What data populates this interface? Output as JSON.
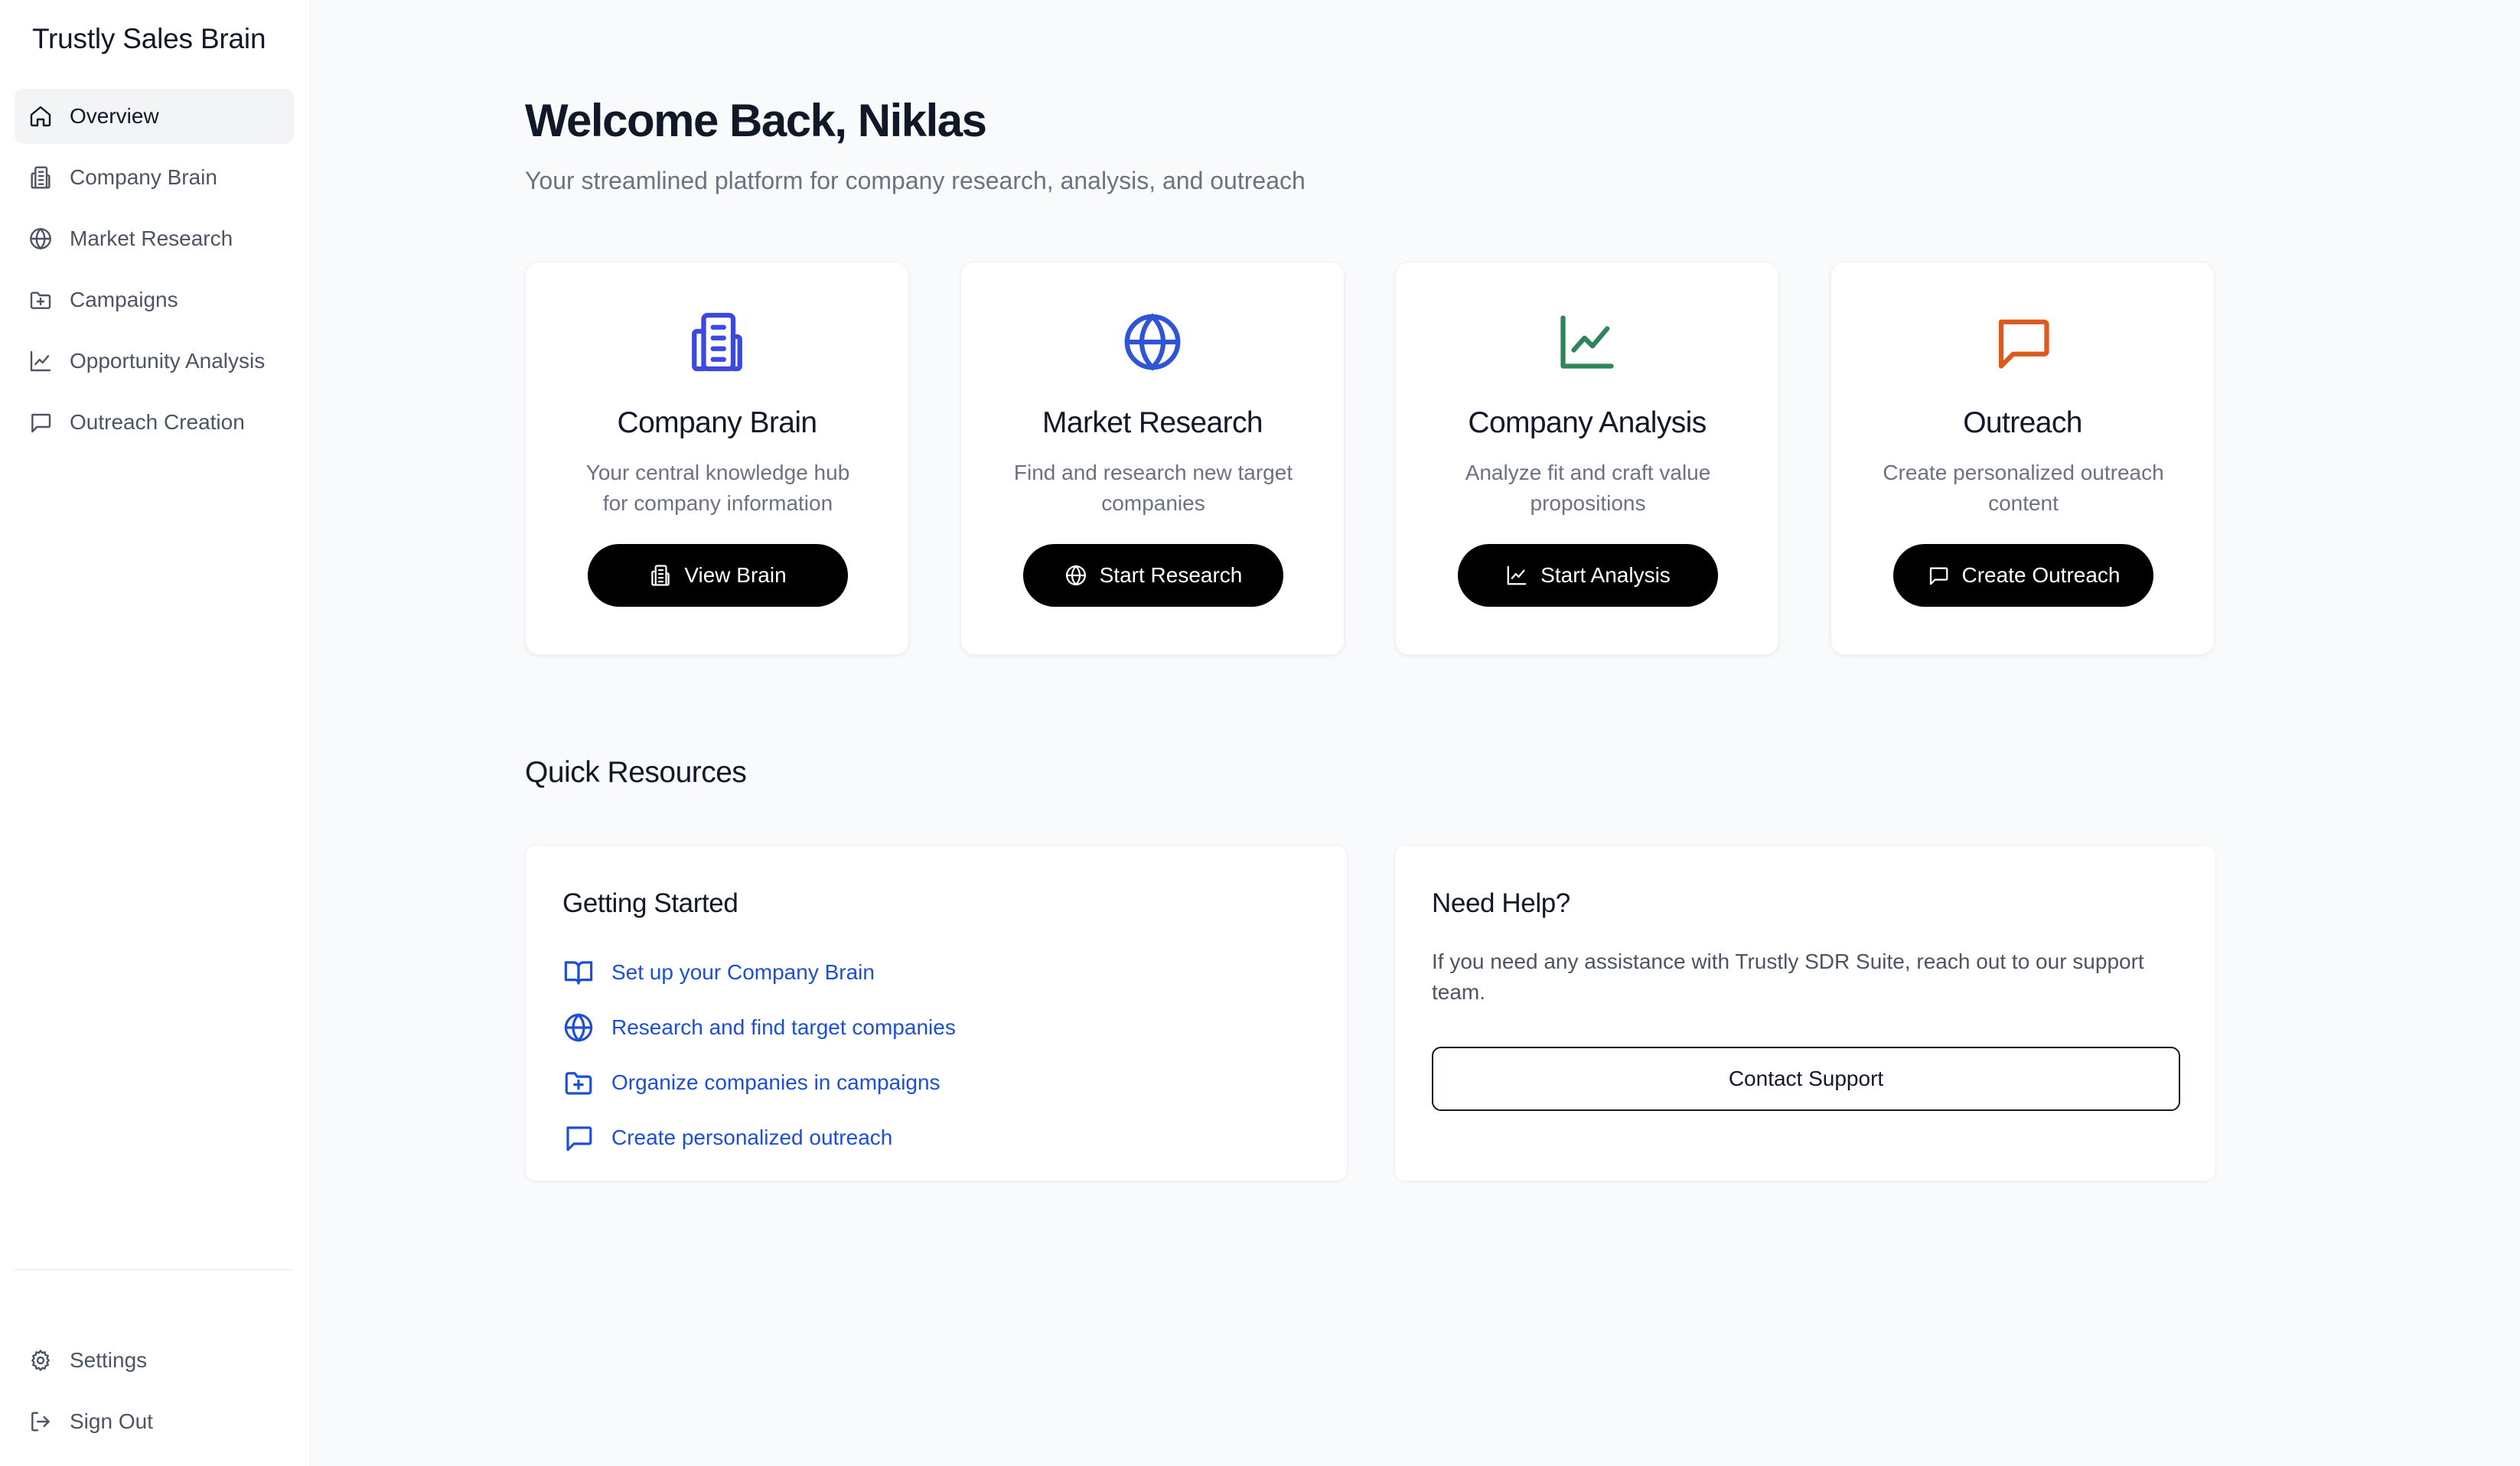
{
  "app": {
    "title": "Trustly Sales Brain"
  },
  "sidebar": {
    "items": [
      {
        "label": "Overview",
        "icon": "home-icon",
        "active": true
      },
      {
        "label": "Company Brain",
        "icon": "building-icon"
      },
      {
        "label": "Market Research",
        "icon": "globe-icon"
      },
      {
        "label": "Campaigns",
        "icon": "folder-plus-icon"
      },
      {
        "label": "Opportunity Analysis",
        "icon": "line-chart-icon"
      },
      {
        "label": "Outreach Creation",
        "icon": "message-square-icon"
      }
    ],
    "bottom_items": [
      {
        "label": "Settings",
        "icon": "gear-icon"
      },
      {
        "label": "Sign Out",
        "icon": "log-out-icon"
      }
    ]
  },
  "header": {
    "title": "Welcome Back, Niklas",
    "subtitle": "Your streamlined platform for company research, analysis, and outreach"
  },
  "cards": [
    {
      "title": "Company Brain",
      "description": "Your central knowledge hub for company information",
      "button": "View Brain",
      "icon": "building-icon",
      "color": "#3b49df"
    },
    {
      "title": "Market Research",
      "description": "Find and research new target companies",
      "button": "Start Research",
      "icon": "globe-icon",
      "color": "#2f55d4"
    },
    {
      "title": "Company Analysis",
      "description": "Analyze fit and craft value propositions",
      "button": "Start Analysis",
      "icon": "line-chart-icon",
      "color": "#2f855a"
    },
    {
      "title": "Outreach",
      "description": "Create personalized outreach content",
      "button": "Create Outreach",
      "icon": "message-square-icon",
      "color": "#dd5a1f"
    }
  ],
  "quick_resources": {
    "title": "Quick Resources",
    "getting_started": {
      "title": "Getting Started",
      "items": [
        {
          "label": "Set up your Company Brain",
          "icon": "book-open-icon"
        },
        {
          "label": "Research and find target companies",
          "icon": "globe-icon"
        },
        {
          "label": "Organize companies in campaigns",
          "icon": "folder-plus-icon"
        },
        {
          "label": "Create personalized outreach",
          "icon": "message-square-icon"
        }
      ]
    },
    "help": {
      "title": "Need Help?",
      "text": "If you need any assistance with Trustly SDR Suite, reach out to our support team.",
      "button": "Contact Support"
    }
  },
  "colors": {
    "link": "#1d4ed8",
    "button_bg": "#000000",
    "page_bg": "#f9fafb"
  }
}
